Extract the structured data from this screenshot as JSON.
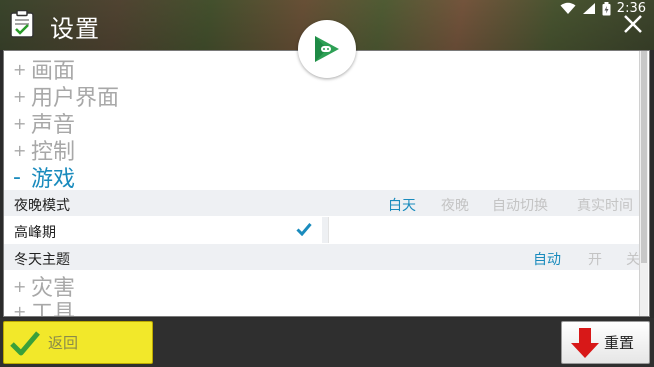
{
  "header": {
    "title": "设置",
    "time": "2:36"
  },
  "categories": [
    {
      "label": "画面",
      "sign": "+"
    },
    {
      "label": "用户界面",
      "sign": "+"
    },
    {
      "label": "声音",
      "sign": "+"
    },
    {
      "label": "控制",
      "sign": "+"
    },
    {
      "label": "游戏",
      "sign": "-"
    },
    {
      "label": "灾害",
      "sign": "+"
    },
    {
      "label": "工具",
      "sign": "+"
    }
  ],
  "settings": {
    "night_mode": {
      "label": "夜晚模式",
      "options": [
        "白天",
        "夜晚",
        "自动切换",
        "真实时间"
      ],
      "selected": "白天"
    },
    "peak": {
      "label": "高峰期",
      "checked": true
    },
    "winter": {
      "label": "冬天主题",
      "options": [
        "自动",
        "开",
        "关"
      ],
      "selected": "自动"
    }
  },
  "buttons": {
    "back": "返回",
    "reset": "重置"
  },
  "colors": {
    "accent": "#1a8bbd",
    "back_button": "#f2e82a",
    "inactive_text": "#a8a8a8"
  }
}
